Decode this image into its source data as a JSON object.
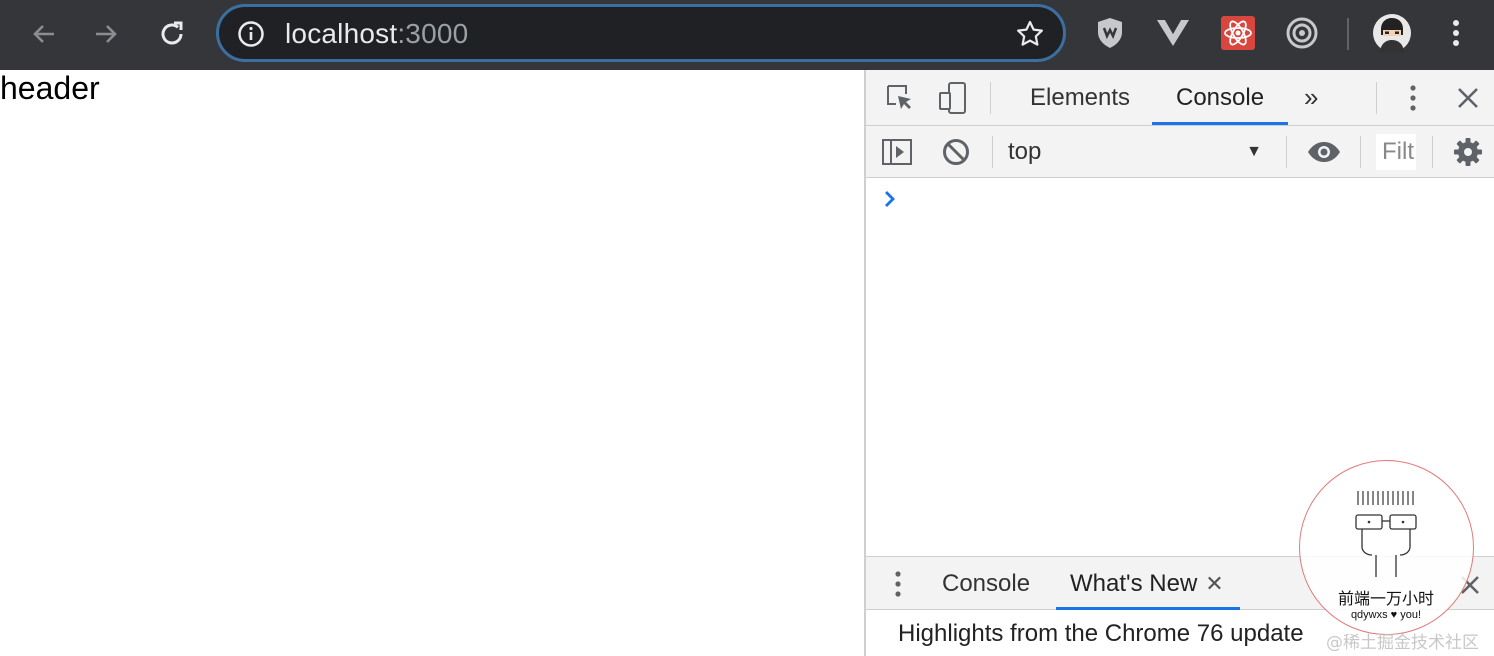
{
  "browser": {
    "url_host": "localhost",
    "url_port": ":3000",
    "icons": {
      "back": "back-arrow-icon",
      "forward": "forward-arrow-icon",
      "reload": "reload-icon",
      "info": "info-icon",
      "bookmark": "star-icon"
    },
    "extensions": [
      "ublock-shield-icon",
      "vue-devtools-icon",
      "react-devtools-icon",
      "target-extension-icon",
      "profile-avatar-icon",
      "chrome-menu-icon"
    ]
  },
  "page": {
    "header_text": "header"
  },
  "devtools": {
    "tabs": [
      {
        "label": "Elements",
        "active": false
      },
      {
        "label": "Console",
        "active": true
      }
    ],
    "more_tabs": "»",
    "console": {
      "context": "top",
      "filter_placeholder": "Filt"
    },
    "drawer": {
      "tabs": [
        {
          "label": "Console",
          "active": false
        },
        {
          "label": "What's New",
          "active": true
        }
      ],
      "content_title": "Highlights from the Chrome 76 update"
    }
  },
  "overlay": {
    "stamp_title": "前端一万小时",
    "stamp_sub": "qdywxs ♥ you!",
    "watermark": "@稀土掘金技术社区"
  },
  "colors": {
    "toolbar_bg": "#35363a",
    "accent_blue": "#1a73e8",
    "devtools_bg": "#f3f3f3"
  }
}
